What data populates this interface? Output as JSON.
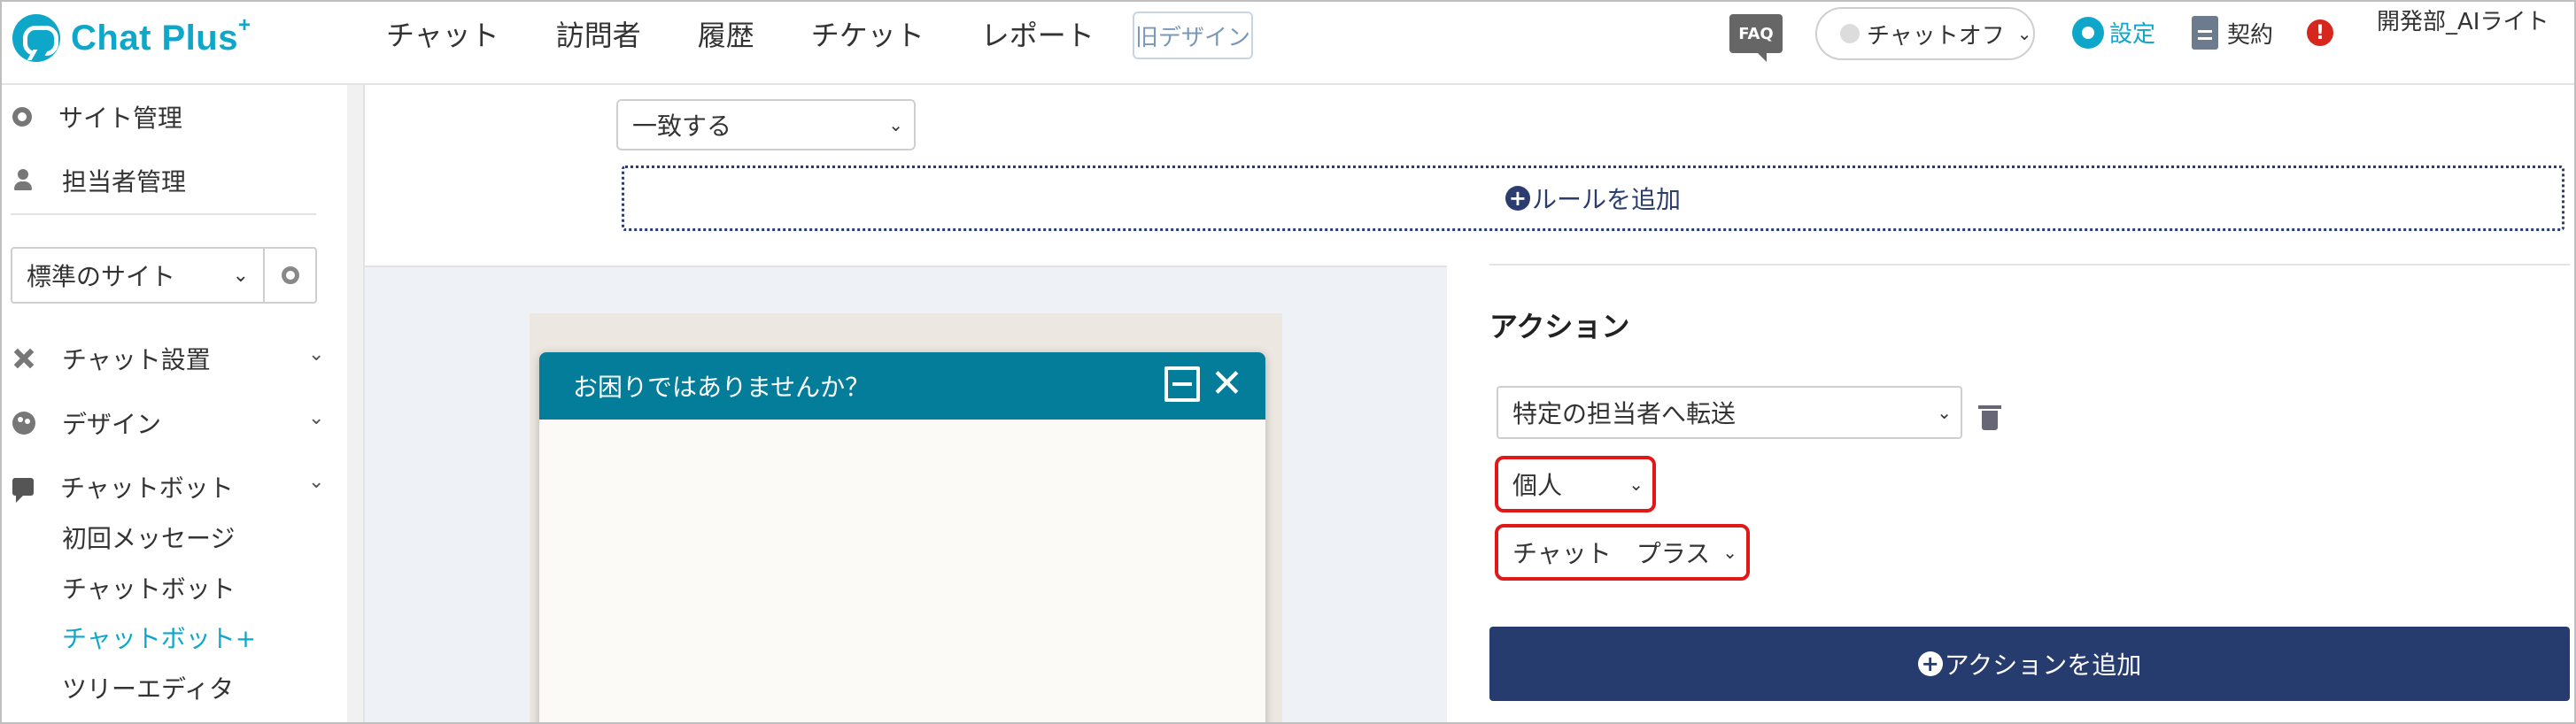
{
  "app": {
    "logo_text": "Chat Plus",
    "logo_sup": "+"
  },
  "header": {
    "nav": [
      "チャット",
      "訪問者",
      "履歴",
      "チケット",
      "レポート"
    ],
    "old_design": "旧デザイン",
    "faq": "FAQ",
    "chat_status": "チャットオフ",
    "settings": "設定",
    "contract": "契約",
    "alert": "!",
    "user": "開発部_AIライト"
  },
  "sidebar": {
    "site_admin": "サイト管理",
    "staff_admin": "担当者管理",
    "site_select": "標準のサイト",
    "chat_settings": "チャット設置",
    "design": "デザイン",
    "chatbot": "チャットボット",
    "sub_items": [
      "初回メッセージ",
      "チャットボット",
      "チャットボット+",
      "ツリーエディタ"
    ],
    "active_sub": "チャットボット+"
  },
  "main": {
    "match_select": "一致する",
    "add_rule": "ルールを追加",
    "preview": {
      "header": "お困りではありませんか？"
    },
    "action": {
      "title": "アクション",
      "action_select": "特定の担当者へ転送",
      "type_select": "個人",
      "person_select": "チャット　プラス",
      "add_action": "アクションを追加"
    }
  },
  "colors": {
    "brand": "#0ea7c9",
    "chat_header": "#037d99",
    "primary_button": "#273c6e",
    "highlight": "#e01818"
  }
}
